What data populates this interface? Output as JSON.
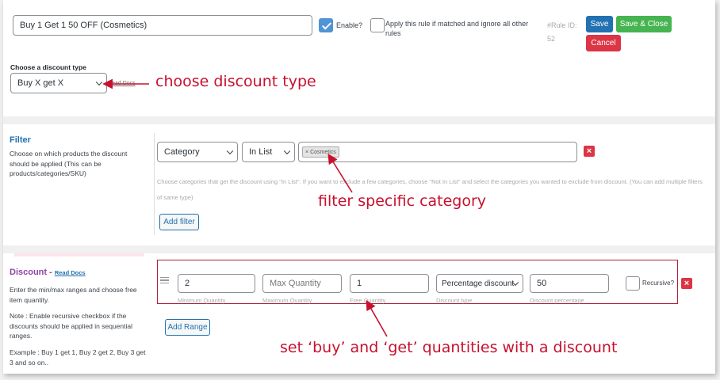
{
  "rule": {
    "title_value": "Buy 1 Get 1 50 OFF (Cosmetics)",
    "enable_label": "Enable?",
    "enable_checked": true,
    "apply_rule_label": "Apply this rule if matched and ignore all other rules",
    "rule_id_label": "#Rule ID:",
    "rule_id_value": "52",
    "save_label": "Save",
    "save_close_label": "Save & Close",
    "cancel_label": "Cancel"
  },
  "discount_type": {
    "label": "Choose a discount type",
    "selected": "Buy X get X",
    "read_docs": "Read Docs"
  },
  "filter": {
    "title": "Filter",
    "description": "Choose on which products the discount should be applied (This can be products/categories/SKU)",
    "type_selected": "Category",
    "method_selected": "In List",
    "tag_value": "Cosmetics",
    "tag_remove": "×",
    "help_text": "Choose categories that get the discount using \"In List\". If you want to exclude a few categories, choose \"Not In List\" and select the categories you wanted to exclude from discount. (You can add multiple filters of same type)",
    "add_filter_label": "Add filter"
  },
  "discount": {
    "title": "Discount",
    "title_sep": " - ",
    "read_docs": "Read Docs",
    "desc1": "Enter the min/max ranges and choose free item quantity.",
    "desc2": "Note : Enable recursive checkbox if the discounts should be applied in sequential ranges.",
    "desc3": "Example : Buy 1 get 1, Buy 2 get 2, Buy 3 get 3 and so on..",
    "min_qty_value": "2",
    "min_qty_label": "Minimum Quantity",
    "max_qty_placeholder": "Max Quantity",
    "max_qty_label": "Maximum Quantity",
    "free_qty_value": "1",
    "free_qty_label": "Free Quantity",
    "discount_type_selected": "Percentage discount",
    "discount_type_label": "Discount type",
    "discount_value": "50",
    "discount_value_label": "Discount percentage",
    "recursive_label": "Recursive?",
    "add_range_label": "Add Range"
  },
  "annotations": {
    "discount_type": "choose discount type",
    "filter": "filter specific category",
    "quantities": "set ‘buy’ and ‘get’ quantities with a discount"
  },
  "colors": {
    "annotation": "#c8102e",
    "save": "#2271b1",
    "save_close": "#46b450",
    "cancel": "#dc3545",
    "filter_title": "#2271b1",
    "discount_title": "#8e44ad"
  }
}
